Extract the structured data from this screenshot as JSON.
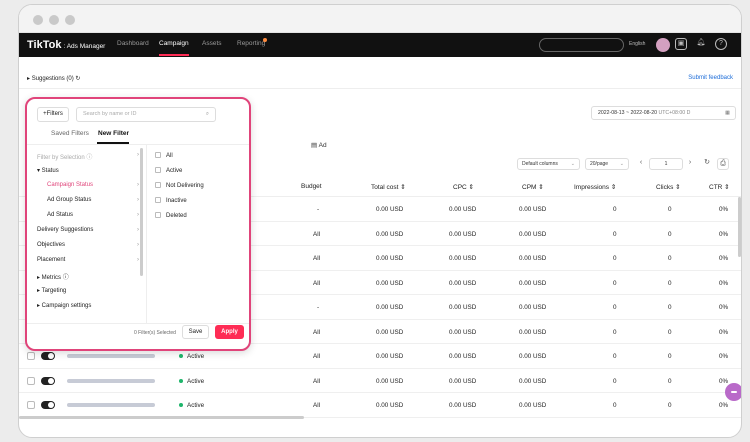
{
  "nav": {
    "logo": "TikTok",
    "logo_sub": ": Ads Manager",
    "items": [
      "Dashboard",
      "Campaign",
      "Assets",
      "Reporting"
    ],
    "language": "English"
  },
  "suggestions": {
    "label": "Suggestions (0)",
    "submit_feedback": "Submit feedback"
  },
  "date_range": {
    "start": "2022-08-13",
    "end": "2022-08-20",
    "timezone": "UTC+08:00 D"
  },
  "ad_tab": "Ad",
  "toolbar": {
    "columns": "Default columns",
    "per_page": "20/page",
    "page": "1"
  },
  "table": {
    "headers": [
      "Budget",
      "Total cost",
      "CPC",
      "CPM",
      "Impressions",
      "Clicks",
      "CTR"
    ],
    "rows": [
      {
        "status": "",
        "budget": "-",
        "total_cost": "0.00 USD",
        "cpc": "0.00 USD",
        "cpm": "0.00 USD",
        "impressions": "0",
        "clicks": "0",
        "ctr": "0%"
      },
      {
        "status": "",
        "budget": "All",
        "total_cost": "0.00 USD",
        "cpc": "0.00 USD",
        "cpm": "0.00 USD",
        "impressions": "0",
        "clicks": "0",
        "ctr": "0%"
      },
      {
        "status": "",
        "budget": "All",
        "total_cost": "0.00 USD",
        "cpc": "0.00 USD",
        "cpm": "0.00 USD",
        "impressions": "0",
        "clicks": "0",
        "ctr": "0%"
      },
      {
        "status": "",
        "budget": "All",
        "total_cost": "0.00 USD",
        "cpc": "0.00 USD",
        "cpm": "0.00 USD",
        "impressions": "0",
        "clicks": "0",
        "ctr": "0%"
      },
      {
        "status": "",
        "budget": "-",
        "total_cost": "0.00 USD",
        "cpc": "0.00 USD",
        "cpm": "0.00 USD",
        "impressions": "0",
        "clicks": "0",
        "ctr": "0%"
      },
      {
        "status": "",
        "budget": "All",
        "total_cost": "0.00 USD",
        "cpc": "0.00 USD",
        "cpm": "0.00 USD",
        "impressions": "0",
        "clicks": "0",
        "ctr": "0%"
      },
      {
        "status": "Active",
        "budget": "All",
        "total_cost": "0.00 USD",
        "cpc": "0.00 USD",
        "cpm": "0.00 USD",
        "impressions": "0",
        "clicks": "0",
        "ctr": "0%"
      },
      {
        "status": "Active",
        "budget": "All",
        "total_cost": "0.00 USD",
        "cpc": "0.00 USD",
        "cpm": "0.00 USD",
        "impressions": "0",
        "clicks": "0",
        "ctr": "0%"
      },
      {
        "status": "Active",
        "budget": "All",
        "total_cost": "0.00 USD",
        "cpc": "0.00 USD",
        "cpm": "0.00 USD",
        "impressions": "0",
        "clicks": "0",
        "ctr": "0%"
      }
    ]
  },
  "filter": {
    "button": "+Filters",
    "search_placeholder": "Search by name or ID",
    "tabs": [
      "Saved Filters",
      "New Filter"
    ],
    "left_items": [
      {
        "label": "Filter by Selection",
        "style": "muted"
      },
      {
        "label": "▾  Status",
        "style": "normal"
      },
      {
        "label": "Campaign Status",
        "style": "sel"
      },
      {
        "label": "Ad Group Status",
        "style": "normal"
      },
      {
        "label": "Ad Status",
        "style": "normal"
      },
      {
        "label": "Delivery Suggestions",
        "style": "normal"
      },
      {
        "label": "Objectives",
        "style": "normal"
      },
      {
        "label": "Placement",
        "style": "normal"
      },
      {
        "label": "▸  Metrics",
        "style": "normal"
      },
      {
        "label": "▸  Targeting",
        "style": "normal"
      },
      {
        "label": "▸  Campaign settings",
        "style": "normal"
      }
    ],
    "options": [
      "All",
      "Active",
      "Not Delivering",
      "Inactive",
      "Deleted"
    ],
    "selected_count": "0 Filter(s) Selected",
    "save": "Save",
    "apply": "Apply"
  }
}
